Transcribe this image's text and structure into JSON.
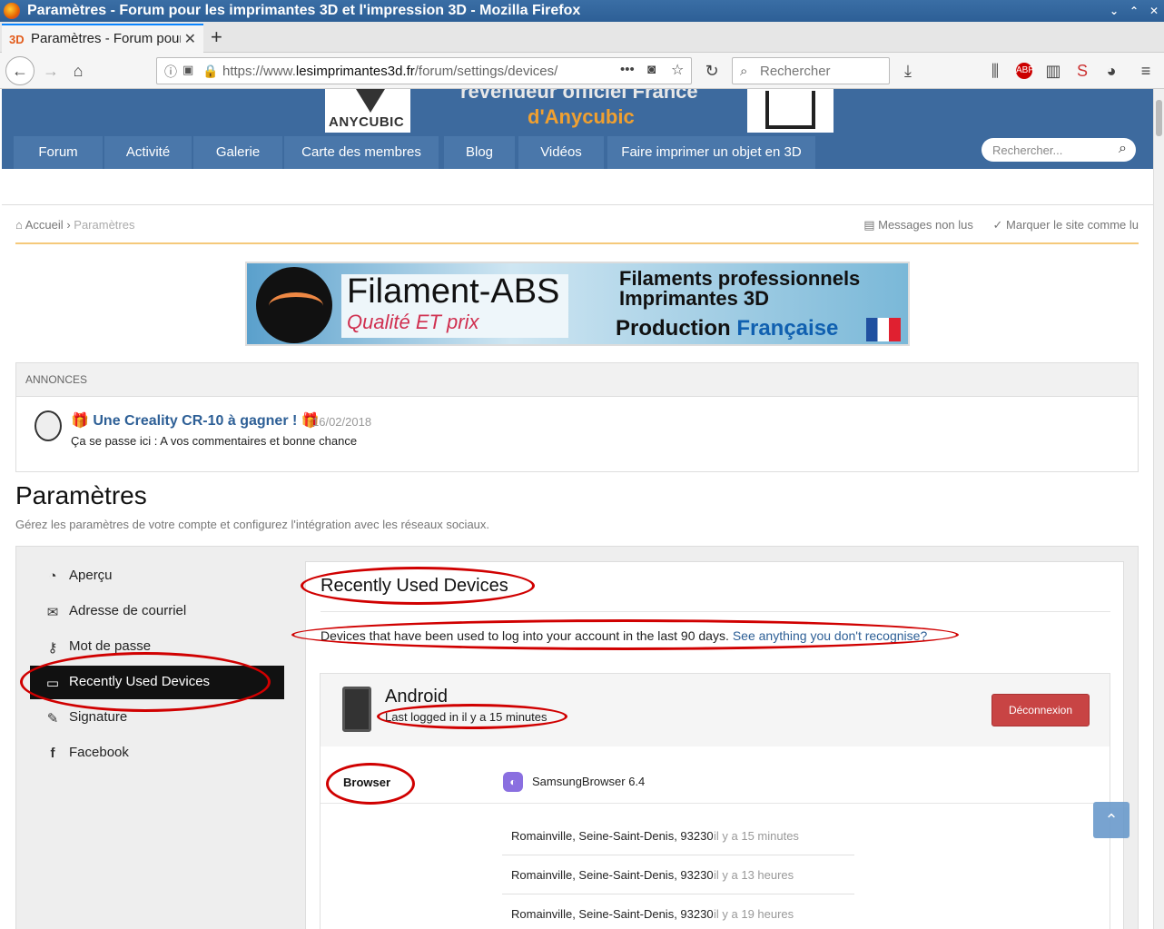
{
  "window": {
    "title": "Paramètres - Forum pour les imprimantes 3D et l'impression 3D - Mozilla Firefox"
  },
  "browser": {
    "tab_favicon": "3D",
    "tab_title": "Paramètres - Forum pour les imprimantes 3D et l'impression 3D",
    "url_prefix": "https://www.",
    "url_domain": "lesimprimantes3d.fr",
    "url_rest": "/forum/settings/devices/",
    "search_placeholder": "Rechercher",
    "more_actions": "•••"
  },
  "site": {
    "banner_line1": "revendeur officiel France",
    "banner_line2": "d'Anycubic",
    "logo_text": "ANYCUBIC",
    "nav": [
      "Forum",
      "Activité",
      "Galerie",
      "Carte des membres",
      "Blog",
      "Vidéos",
      "Faire imprimer un objet en 3D"
    ],
    "search_placeholder": "Rechercher...",
    "breadcrumb_home": "Accueil",
    "breadcrumb_sep": "›",
    "breadcrumb_current": "Paramètres",
    "unread": "Messages non lus",
    "mark_read": "Marquer le site comme lu"
  },
  "ad": {
    "brand": "Filament-ABS",
    "tagline": "Qualité ET prix",
    "line1": "Filaments professionnels",
    "line2": "Imprimantes 3D",
    "production": "Production",
    "francaise": "Française"
  },
  "announcements": {
    "header": "ANNONCES",
    "title": "🎁 Une Creality CR-10 à gagner ! 🎁",
    "date": "16/02/2018",
    "subtitle": "Ça se passe ici : A vos commentaires et bonne chance"
  },
  "page": {
    "title": "Paramètres",
    "description": "Gérez les paramètres de votre compte et configurez l'intégration avec les réseaux sociaux."
  },
  "sidebar": {
    "items": [
      {
        "label": "Aperçu",
        "icon": "dashboard-icon"
      },
      {
        "label": "Adresse de courriel",
        "icon": "envelope-icon"
      },
      {
        "label": "Mot de passe",
        "icon": "key-icon"
      },
      {
        "label": "Recently Used Devices",
        "icon": "laptop-icon"
      },
      {
        "label": "Signature",
        "icon": "pencil-icon"
      },
      {
        "label": "Facebook",
        "icon": "facebook-icon"
      }
    ],
    "active_index": 3
  },
  "devices": {
    "title": "Recently Used Devices",
    "intro": "Devices that have been used to log into your account in the last 90 days.",
    "link": "See anything you don't recognise?",
    "device_name": "Android",
    "last_logged": "Last logged in il y a 15 minutes",
    "logout_button": "Déconnexion",
    "browser_label": "Browser",
    "browser_value": "SamsungBrowser 6.4",
    "locations": [
      {
        "place": "Romainville, Seine-Saint-Denis, 93230",
        "when": "il y a 15 minutes"
      },
      {
        "place": "Romainville, Seine-Saint-Denis, 93230",
        "when": "il y a 13 heures"
      },
      {
        "place": "Romainville, Seine-Saint-Denis, 93230",
        "when": "il y a 19 heures"
      }
    ]
  },
  "colors": {
    "brand_blue": "#3d6a9e",
    "annotation_red": "#d00000",
    "logout_red": "#c84444"
  }
}
